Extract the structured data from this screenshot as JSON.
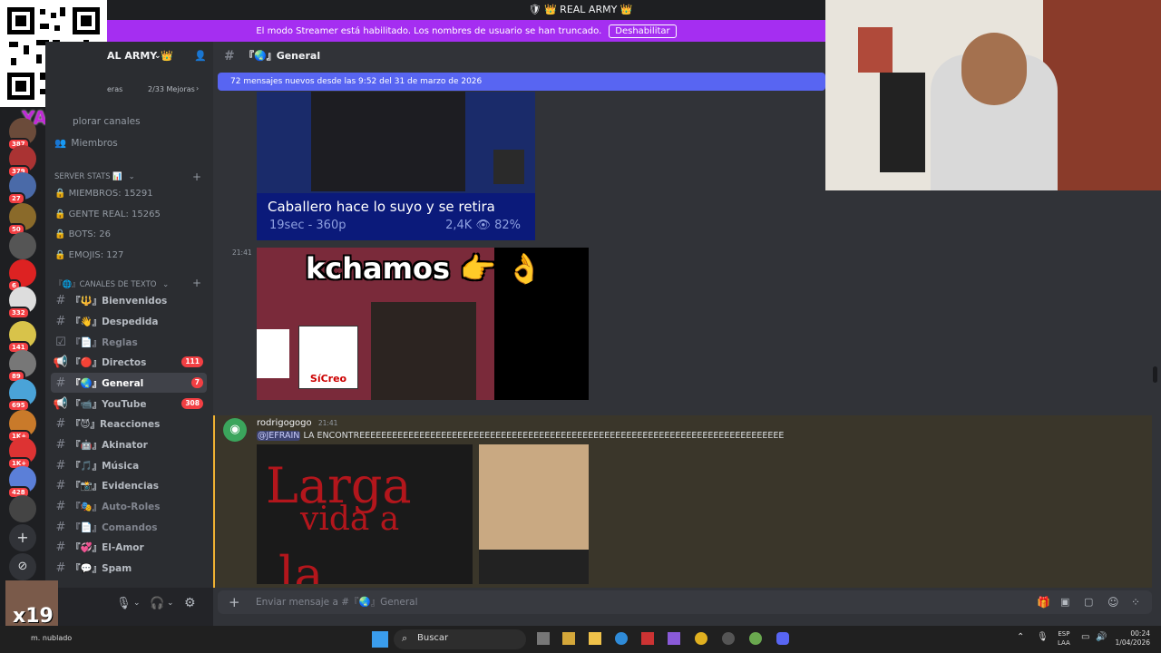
{
  "window": {
    "title": "🛡 👑 REAL ARMY 👑"
  },
  "banner": {
    "text": "El modo Streamer está habilitado. Los nombres de usuario se han truncado.",
    "button": "Deshabilitar"
  },
  "server": {
    "name": "AL ARMY 👑",
    "boosts_label": "eras",
    "boosts_count": "2/33 Mejoras"
  },
  "overlay": {
    "yape": "YAPE",
    "x19": "x19"
  },
  "sidebar": {
    "top_items": [
      "plorar canales",
      "Miembros"
    ],
    "stats_category": "SERVER STATS 📊",
    "stats": [
      "MIEMBROS: 15291",
      "GENTE REAL: 15265",
      "BOTS: 26",
      "EMOJIS: 127"
    ],
    "text_category": "『🌐』CANALES DE TEXTO",
    "channels": [
      {
        "label": "『🔱』Bienvenidos",
        "badge": ""
      },
      {
        "label": "『👋』Despedida",
        "badge": ""
      },
      {
        "label": "『📄』Reglas",
        "badge": ""
      },
      {
        "label": "『🔴』Directos",
        "badge": "111"
      },
      {
        "label": "『🌏』General",
        "badge": "7"
      },
      {
        "label": "『📹』YouTube",
        "badge": "308"
      },
      {
        "label": "『😈』Reacciones",
        "badge": ""
      },
      {
        "label": "『🤖』Akinator",
        "badge": ""
      },
      {
        "label": "『🎵』Música",
        "badge": ""
      },
      {
        "label": "『📸』Evidencias",
        "badge": ""
      },
      {
        "label": "『🎭』Auto-Roles",
        "badge": ""
      },
      {
        "label": "『📄』Comandos",
        "badge": ""
      },
      {
        "label": "『💞』El-Amor",
        "badge": ""
      },
      {
        "label": "『💬』Spam",
        "badge": ""
      }
    ]
  },
  "server_badges": [
    "387",
    "379",
    "27",
    "50",
    "",
    "6",
    "332",
    "141",
    "89",
    "695",
    "1K+",
    "1K+",
    "428"
  ],
  "channel_header": {
    "name": "『🌏』General"
  },
  "new_messages": {
    "text": "72 mensajes nuevos desde las 9:52 del 31 de marzo de 2026"
  },
  "messages": [
    {
      "caption": "Caballero hace lo suyo y se retira",
      "meta_left": "19sec - 360p",
      "meta_right": "2,4K 👁 82%"
    },
    {
      "time": "21:41",
      "caption": "kchamos 👉 👌",
      "logo": "SíCreo"
    },
    {
      "author": "rodrigogogo",
      "time": "21:41",
      "mention": "@JEFRAIN",
      "text": "LA ENCONTREEEEEEEEEEEEEEEEEEEEEEEEEEEEEEEEEEEEEEEEEEEEEEEEEEEEEEEEEEEEEEEEEEEEEEEEEEEEEE",
      "image_text": [
        "Larga",
        "vida a",
        "la"
      ]
    }
  ],
  "composer": {
    "placeholder": "Enviar mensaje a #『🌏』General"
  },
  "taskbar": {
    "search": "Buscar",
    "weather": "m. nublado",
    "lang1": "ESP",
    "lang2": "LAA",
    "time": "00:24",
    "date": "1/04/2026"
  }
}
